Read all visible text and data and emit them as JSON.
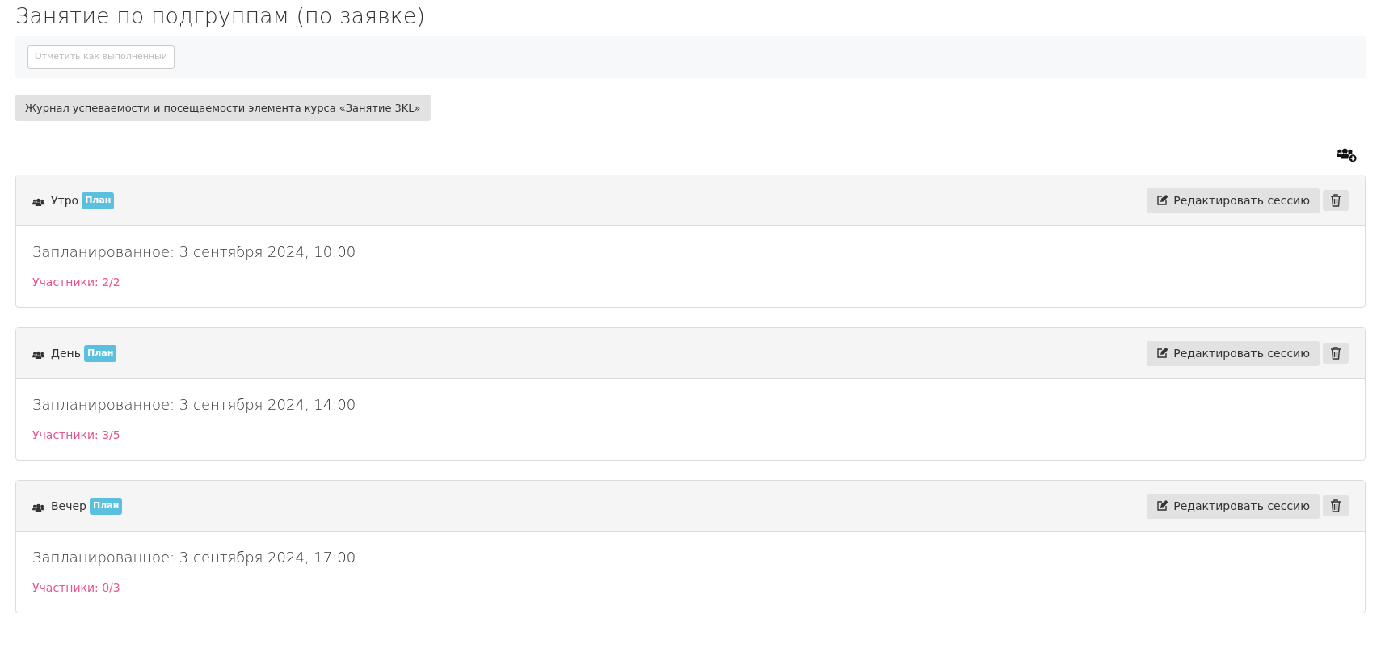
{
  "title": "Занятие по подгруппам (по заявке)",
  "completion_button": {
    "label": "Отметить как выполненный",
    "disabled": true
  },
  "journal_button": {
    "label": "Журнал успеваемости и посещаемости элемента курса «Занятие 3KL»"
  },
  "sessions": [
    {
      "name": "Утро",
      "badge": "План",
      "edit_label": "Редактировать сессию",
      "scheduled": "Запланированное: 3 сентября 2024, 10:00",
      "participants": "Участники: 2/2"
    },
    {
      "name": "День",
      "badge": "План",
      "edit_label": "Редактировать сессию",
      "scheduled": "Запланированное: 3 сентября 2024, 14:00",
      "participants": "Участники: 3/5"
    },
    {
      "name": "Вечер",
      "badge": "План",
      "edit_label": "Редактировать сессию",
      "scheduled": "Запланированное: 3 сентября 2024, 17:00",
      "participants": "Участники: 0/3"
    }
  ]
}
